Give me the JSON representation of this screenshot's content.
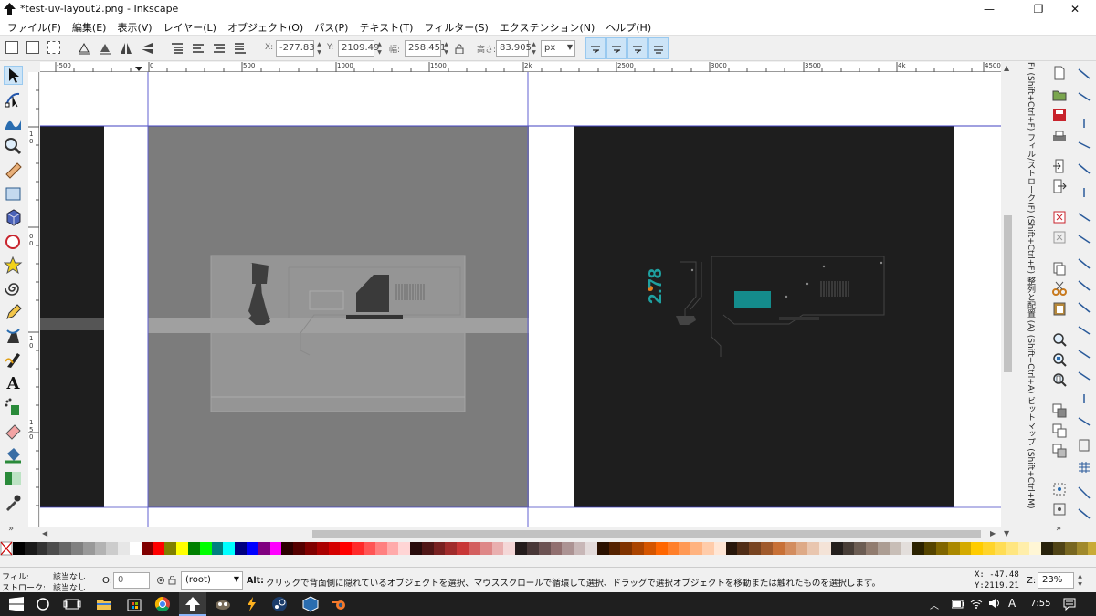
{
  "window": {
    "title": "*test-uv-layout2.png - Inkscape",
    "minimize": "—",
    "restore": "❐",
    "close": "✕"
  },
  "menu": [
    "ファイル(F)",
    "編集(E)",
    "表示(V)",
    "レイヤー(L)",
    "オブジェクト(O)",
    "パス(P)",
    "テキスト(T)",
    "フィルター(S)",
    "エクステンション(N)",
    "ヘルプ(H)"
  ],
  "toolbar": {
    "x_label": "X:",
    "x_value": "-277.83",
    "y_label": "Y:",
    "y_value": "2109.49",
    "w_label": "幅:",
    "w_value": "258.451",
    "h_label": "高さ:",
    "h_value": "83.905",
    "unit": "px",
    "lock_icon": "lock-icon"
  },
  "ruler_top": [
    "-500",
    "0",
    "500",
    "1000",
    "1500",
    "2k",
    "2500",
    "3000",
    "3500",
    "4k",
    "4500"
  ],
  "ruler_left": [
    "1",
    "0",
    "0",
    "0",
    "1",
    "0",
    "1",
    "5",
    "0"
  ],
  "canvas": {
    "badge_text": "2.78",
    "colors": {
      "dark": "#1e1e1e",
      "gray_page": "#7c7c7c",
      "uv_panel": "#939393",
      "teal": "#148c8c",
      "teal_text": "#1fa0a0",
      "guide": "#4040c0"
    }
  },
  "side_panel_text": "F) (Shift+Ctrl+F)  フィル/ストローク(F) (Shift+Ctrl+F)  整列と配置 (A) (Shift+Ctrl+A)  ビットマップ (Shift+Ctrl+M)",
  "palette": [
    "#000000",
    "#1a1a1a",
    "#333333",
    "#4d4d4d",
    "#666666",
    "#808080",
    "#999999",
    "#b3b3b3",
    "#cccccc",
    "#e6e6e6",
    "#ffffff",
    "#800000",
    "#ff0000",
    "#808000",
    "#ffff00",
    "#008000",
    "#00ff00",
    "#008080",
    "#00ffff",
    "#000080",
    "#0000ff",
    "#800080",
    "#ff00ff",
    "#2b0000",
    "#550000",
    "#800000",
    "#aa0000",
    "#d40000",
    "#ff0000",
    "#ff2a2a",
    "#ff5555",
    "#ff8080",
    "#ffaaaa",
    "#ffd5d5",
    "#280b0b",
    "#501616",
    "#782121",
    "#a02c2c",
    "#c83737",
    "#d35f5f",
    "#de8787",
    "#e9afaf",
    "#f4d7d7",
    "#241c1c",
    "#483737",
    "#6c5353",
    "#916f6f",
    "#ac9393",
    "#c8b7b7",
    "#e3dbdb",
    "#2b1100",
    "#552200",
    "#803300",
    "#aa4400",
    "#d45500",
    "#ff6600",
    "#ff7f2a",
    "#ff9955",
    "#ffb380",
    "#ffccaa",
    "#ffe6d5",
    "#28170b",
    "#502d16",
    "#784421",
    "#a05a2c",
    "#c87137",
    "#d38d5f",
    "#deaa87",
    "#e9c6af",
    "#f4e3d7",
    "#241f1c",
    "#483e37",
    "#6c5d53",
    "#917c6f",
    "#ac9d93",
    "#c8beb7",
    "#e3dedb",
    "#2b2200",
    "#554400",
    "#806600",
    "#aa8800",
    "#d4aa00",
    "#ffcc00",
    "#ffd42a",
    "#ffdd55",
    "#ffe680",
    "#ffeeaa",
    "#fff6d5",
    "#28220b",
    "#504416",
    "#786721",
    "#a0892c",
    "#c8ab37"
  ],
  "status": {
    "fill_label": "フィル:",
    "fill_value": "該当なし",
    "stroke_label": "ストローク:",
    "stroke_value": "該当なし",
    "opacity_label": "O:",
    "opacity_value": "0",
    "layer": "(root)",
    "message_bold": "Alt:",
    "message": " クリックで背面側に隠れているオブジェクトを選択、マウススクロールで循環して選択、ドラッグで選択オブジェクトを移動または触れたものを選択します。",
    "cursor_x": "X: -47.48",
    "cursor_y": "Y:2119.21",
    "zoom_label": "Z:",
    "zoom": "23%"
  },
  "taskbar": {
    "time": "7:55",
    "ime": "A"
  }
}
